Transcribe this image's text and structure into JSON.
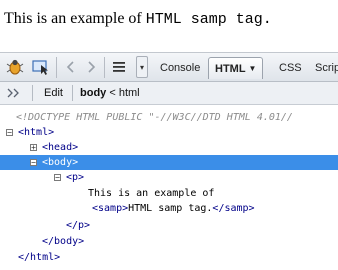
{
  "rendered_page": {
    "text_before": "This is an example of ",
    "samp_text": "HTML samp tag."
  },
  "toolbar": {
    "tabs": [
      {
        "label": "Console"
      },
      {
        "label": "HTML",
        "active": true
      },
      {
        "label": "CSS"
      },
      {
        "label": "Scrip"
      }
    ]
  },
  "breadcrumb": {
    "edit_label": "Edit",
    "current": "body",
    "separator": "<",
    "parent": "html"
  },
  "dom_tree": {
    "doctype": "<!DOCTYPE HTML PUBLIC \"-//W3C//DTD HTML 4.01//",
    "html_open": "<html>",
    "head": "<head>",
    "body_open": "<body>",
    "p_open": "<p>",
    "text_line1": "This is an example of",
    "samp_open": "<samp>",
    "samp_text": "HTML samp tag.",
    "samp_close": "</samp>",
    "p_close": "</p>",
    "body_close": "</body>",
    "html_close": "</html>"
  },
  "colors": {
    "selection": "#3b8ee8",
    "tag": "#000088",
    "doctype": "#8c8c8c"
  }
}
